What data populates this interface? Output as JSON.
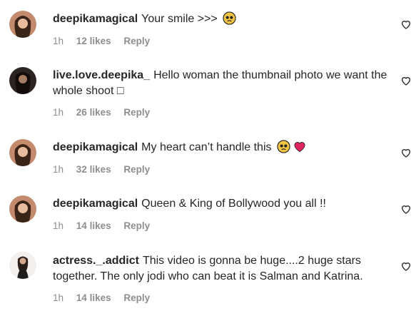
{
  "comments": [
    {
      "username": "deepikamagical",
      "text": "Your smile >>>",
      "time": "1h",
      "likes": "12 likes",
      "reply": "Reply",
      "emoji": [
        "pleading-face-emoji"
      ]
    },
    {
      "username": "live.love.deepika_",
      "text": "Hello woman the thumbnail photo we want the whole shoot □",
      "time": "1h",
      "likes": "26 likes",
      "reply": "Reply",
      "emoji": []
    },
    {
      "username": "deepikamagical",
      "text": "My heart can’t handle this",
      "time": "1h",
      "likes": "32 likes",
      "reply": "Reply",
      "emoji": [
        "pleading-face-emoji",
        "red-heart-emoji"
      ]
    },
    {
      "username": "deepikamagical",
      "text": "Queen & King of Bollywood you all !!",
      "time": "1h",
      "likes": "14 likes",
      "reply": "Reply",
      "emoji": []
    },
    {
      "username": "actress._.addict",
      "text": "This video is gonna be huge....2 huge stars together. The only jodi who can beat it is Salman and Katrina.",
      "time": "1h",
      "likes": "14 likes",
      "reply": "Reply",
      "emoji": []
    }
  ],
  "icons": {
    "like": "heart-outline-icon"
  },
  "colors": {
    "text": "#262626",
    "meta": "#8e8e8e",
    "emoji_face": "#f4c542",
    "heart": "#e0245e"
  }
}
